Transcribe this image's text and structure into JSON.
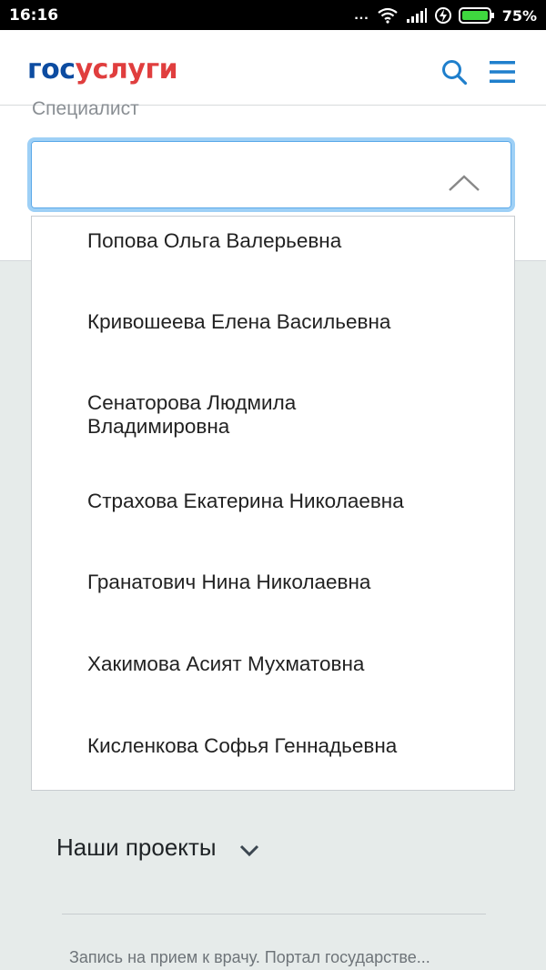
{
  "status_bar": {
    "time": "16:16",
    "dots": "...",
    "battery_percent": "75%"
  },
  "header": {
    "logo_part1": "гос",
    "logo_part2": "услуги",
    "search_icon": "search-icon",
    "menu_icon": "hamburger-menu-icon"
  },
  "form": {
    "field_label": "Специалист",
    "selected_value": ""
  },
  "dropdown": {
    "options": [
      "Попова Ольга Валерьевна",
      "Кривошеева Елена Васильевна",
      "Сенаторова Людмила Владимировна",
      "Страхова Екатерина Николаевна",
      "Гранатович Нина Николаевна",
      "Хакимова Асият Мухматовна",
      "Кисленкова Софья Геннадьевна"
    ]
  },
  "footer": {
    "projects_label": "Наши проекты",
    "description": "Запись на прием к врачу. Портал государстве..."
  },
  "colors": {
    "brand_blue": "#0d4ca1",
    "brand_red": "#e03e3e",
    "icon_blue": "#1f7fcc",
    "focus_blue": "#5aa8e8"
  }
}
